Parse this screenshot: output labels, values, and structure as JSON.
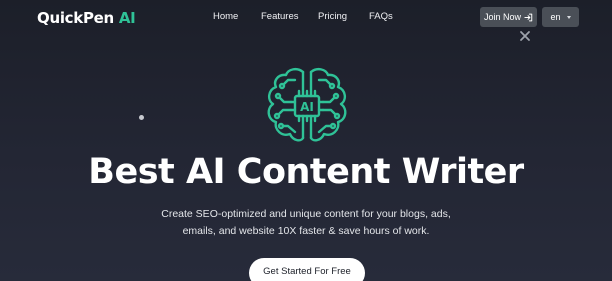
{
  "header": {
    "brand_main": "QuickPen",
    "brand_accent": "AI",
    "nav": {
      "home": "Home",
      "features": "Features",
      "pricing": "Pricing",
      "faqs": "FAQs"
    },
    "join_label": "Join Now",
    "join_icon": "login-arrow-icon",
    "language": "en",
    "language_icon": "caret-down-icon"
  },
  "overlay": {
    "close_icon": "close-icon"
  },
  "hero": {
    "icon": "ai-brain-icon",
    "icon_text": "AI",
    "title": "Best AI Content Writer",
    "subtitle_line1": "Create SEO-optimized and unique content for your blogs, ads,",
    "subtitle_line2": "emails, and website 10X faster & save hours of work.",
    "cta_label": "Get Started For Free"
  },
  "colors": {
    "background": "#1f2230",
    "accent": "#2fc297",
    "button_bg": "#4a4f57",
    "cta_bg": "#ffffff"
  }
}
